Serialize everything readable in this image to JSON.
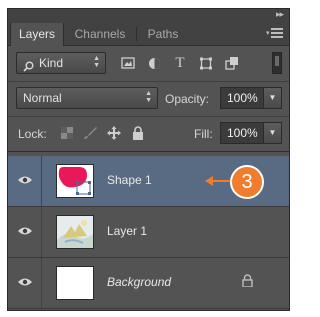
{
  "tabs": [
    {
      "label": "Layers",
      "active": true
    },
    {
      "label": "Channels",
      "active": false
    },
    {
      "label": "Paths",
      "active": false
    }
  ],
  "filter": {
    "kind_label": "Kind",
    "icons": [
      "image-filter-icon",
      "adjustment-filter-icon",
      "type-filter-icon",
      "shape-filter-icon",
      "smart-object-filter-icon"
    ],
    "type_glyph": "T"
  },
  "blend": {
    "mode": "Normal",
    "opacity_label": "Opacity:",
    "opacity_value": "100%"
  },
  "lock": {
    "label": "Lock:",
    "fill_label": "Fill:",
    "fill_value": "100%"
  },
  "layers": [
    {
      "name": "Shape 1",
      "selected": true,
      "thumb": "shape"
    },
    {
      "name": "Layer 1",
      "selected": false,
      "thumb": "image"
    },
    {
      "name": "Background",
      "selected": false,
      "thumb": "white",
      "italic": true,
      "locked": true
    }
  ],
  "callout": {
    "number": "3",
    "color": "#f07d2e"
  },
  "colors": {
    "panel_bg": "#535353",
    "selected_row": "#596a83",
    "shape_fill": "#e8185a"
  }
}
